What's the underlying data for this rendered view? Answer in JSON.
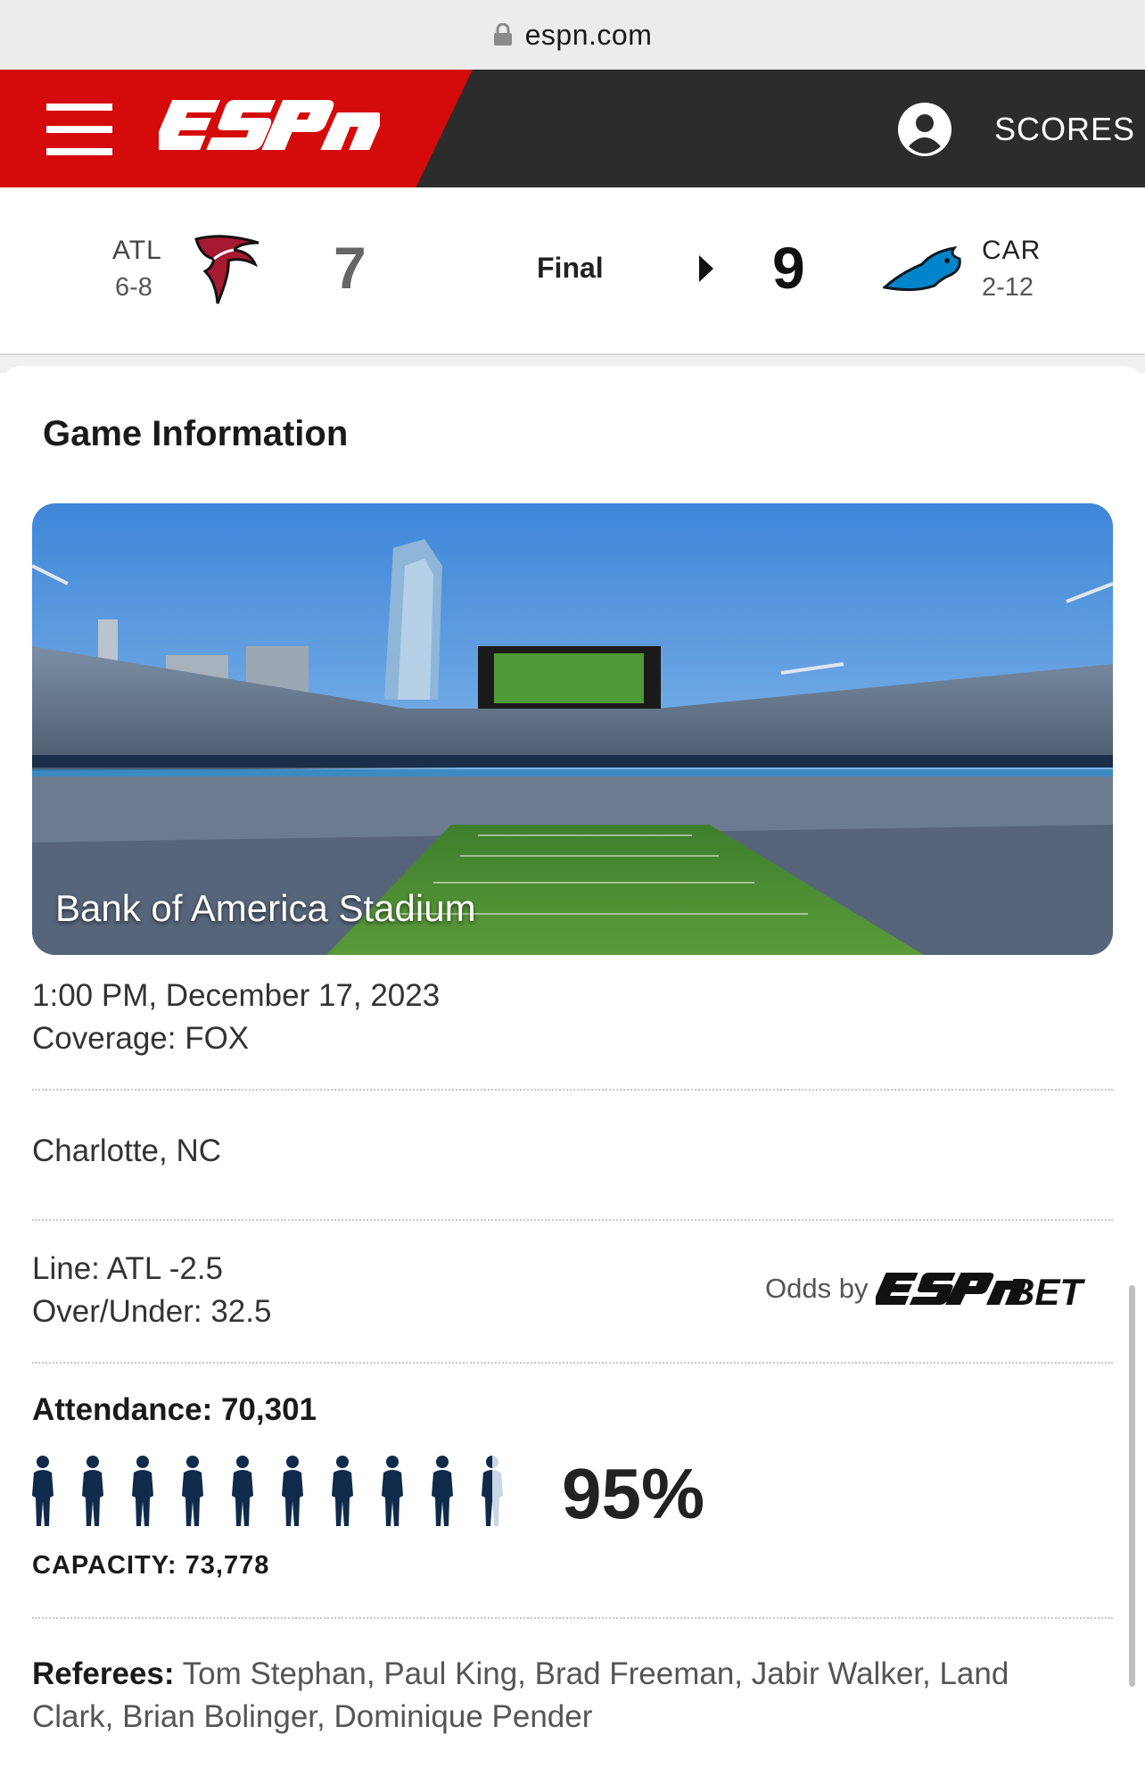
{
  "browser": {
    "url": "espn.com"
  },
  "header": {
    "scores_label": "SCORES"
  },
  "game": {
    "away": {
      "abbr": "ATL",
      "record": "6-8",
      "score": "7"
    },
    "home": {
      "abbr": "CAR",
      "record": "2-12",
      "score": "9"
    },
    "status": "Final"
  },
  "info": {
    "title": "Game Information",
    "stadium_name": "Bank of America Stadium",
    "datetime": "1:00 PM, December 17, 2023",
    "coverage": "Coverage: FOX",
    "location": "Charlotte, NC",
    "line": "Line: ATL -2.5",
    "over_under": "Over/Under: 32.5",
    "odds_by": "Odds by",
    "attendance": "Attendance: 70,301",
    "capacity_pct": "95%",
    "capacity_fraction": 0.95,
    "capacity": "CAPACITY: 73,778",
    "referees_label": "Referees:",
    "referees": "Tom Stephan, Paul King, Brad Freeman, Jabir Walker, Land Clark, Brian Bolinger, Dominique Pender"
  },
  "colors": {
    "espn_red": "#d50a0a",
    "header_dark": "#2c2c2c",
    "person_navy": "#0f2a4a",
    "person_empty": "#c9d6e3"
  },
  "icons": {
    "lock": "lock-icon",
    "menu": "hamburger-menu-icon",
    "account": "account-icon",
    "play": "play-arrow-icon"
  }
}
